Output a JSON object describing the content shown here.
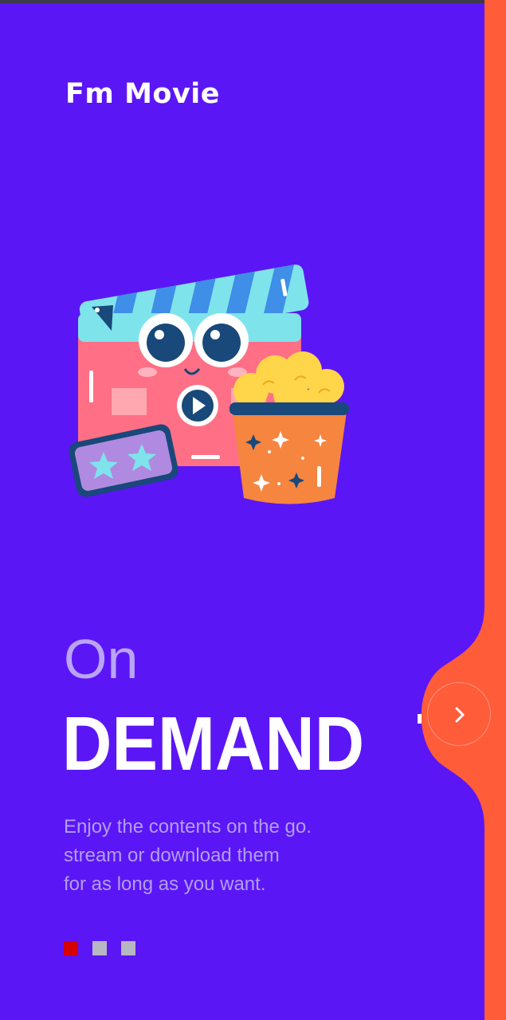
{
  "app": {
    "brand": "Fm Movie"
  },
  "onboarding": {
    "headline_light": "On",
    "headline_bold": "DEMAND",
    "description_lines": [
      "Enjoy the contents on the go.",
      "stream or download them",
      "for as long as you want."
    ],
    "page_count": 3,
    "active_page": 1,
    "next_icon": "chevron-right-icon"
  },
  "colors": {
    "background": "#5b16f5",
    "accent": "#ff5c3a",
    "active_dot": "#d50000",
    "inactive_dot": "#b7b7c4"
  }
}
